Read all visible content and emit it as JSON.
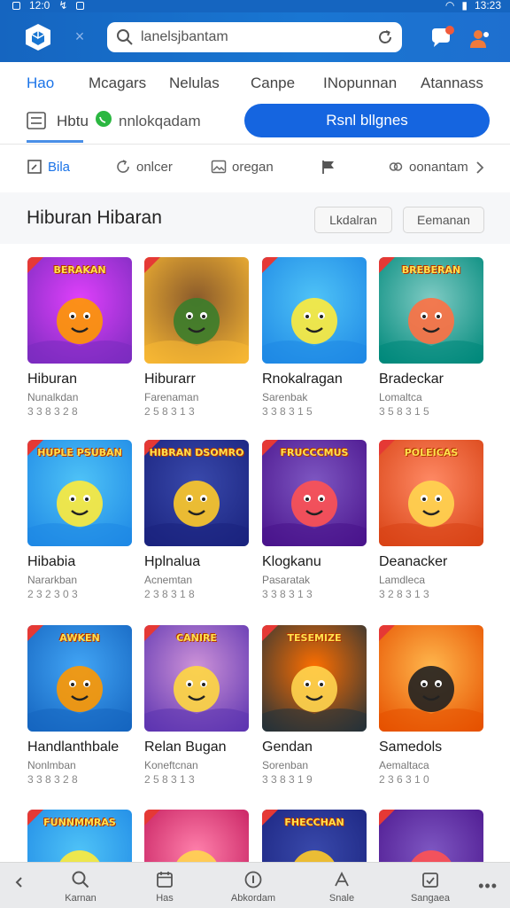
{
  "status_bar": {
    "time_left": "12:0",
    "time_right": "13:23"
  },
  "app_bar": {
    "search_value": "lanelsjbantam",
    "search_placeholder": "lanelsjbantam"
  },
  "category_tabs": [
    {
      "label": "Hao",
      "active": true
    },
    {
      "label": "Mcagars",
      "active": false
    },
    {
      "label": "Nelulas",
      "active": false
    },
    {
      "label": "Canpe",
      "active": false
    },
    {
      "label": "INopunnan",
      "active": false
    },
    {
      "label": "Atannass",
      "active": false
    }
  ],
  "filter": {
    "label": "Hbtu",
    "text": "nnlokqadam",
    "primary_button": "Rsnl bllgnes"
  },
  "chips": [
    {
      "label": "Bila",
      "icon": "square-corner-icon",
      "active": true
    },
    {
      "label": "onlcer",
      "icon": "refresh-icon",
      "active": false
    },
    {
      "label": "oregan",
      "icon": "image-icon",
      "active": false
    },
    {
      "label": "",
      "icon": "flag-icon",
      "active": false
    },
    {
      "label": "oonantam",
      "icon": "link-icon",
      "active": false
    }
  ],
  "section": {
    "title": "Hiburan Hibaran",
    "button_1": "Lkdalran",
    "button_2": "Eemanan"
  },
  "games": [
    {
      "title": "Hiburan",
      "subtitle": "Nunalkdan",
      "meta": "3 3 8 3 2 8",
      "thumb_text": "BERAKAN",
      "theme": "purple"
    },
    {
      "title": "Hiburarr",
      "subtitle": "Farenaman",
      "meta": "2 5 8 3 1 3",
      "thumb_text": "",
      "theme": "sunset"
    },
    {
      "title": "Rnokalragan",
      "subtitle": "Sarenbak",
      "meta": "3 3 8 3 1 5",
      "thumb_text": "",
      "theme": "sky"
    },
    {
      "title": "Bradeckar",
      "subtitle": "Lomaltca",
      "meta": "3 5 8 3 1 5",
      "thumb_text": "BREBERAN",
      "theme": "teal"
    },
    {
      "title": "Hibabia",
      "subtitle": "Nararkban",
      "meta": "2 3 2 3 0 3",
      "thumb_text": "HUPLE PSUBAN",
      "theme": "sky"
    },
    {
      "title": "Hplnalua",
      "subtitle": "Acnemtan",
      "meta": "2 3 8 3 1 8",
      "thumb_text": "HIBRAN DSOMRO",
      "theme": "navy"
    },
    {
      "title": "Klogkanu",
      "subtitle": "Pasaratak",
      "meta": "3 3 8 3 1 3",
      "thumb_text": "FRUCCCMUS",
      "theme": "violet"
    },
    {
      "title": "Deanacker",
      "subtitle": "Lamdleca",
      "meta": "3 2 8 3 1 3",
      "thumb_text": "POLEICAS",
      "theme": "fire"
    },
    {
      "title": "Handlanthbale",
      "subtitle": "Nonlmban",
      "meta": "3 3 8 3 2 8",
      "thumb_text": "AWKEN",
      "theme": "blue"
    },
    {
      "title": "Relan Bugan",
      "subtitle": "Koneftcnan",
      "meta": "2 5 8 3 1 3",
      "thumb_text": "CANIRE",
      "theme": "glow"
    },
    {
      "title": "Gendan",
      "subtitle": "Sorenban",
      "meta": "3 3 8 3 1 9",
      "thumb_text": "TESEMIZE",
      "theme": "dark"
    },
    {
      "title": "Samedols",
      "subtitle": "Aemaltaca",
      "meta": "2 3 6 3 1 0",
      "thumb_text": "",
      "theme": "orange"
    },
    {
      "title": "",
      "subtitle": "",
      "meta": "",
      "thumb_text": "FUNNMMRAS",
      "theme": "sky"
    },
    {
      "title": "",
      "subtitle": "",
      "meta": "",
      "thumb_text": "",
      "theme": "pink"
    },
    {
      "title": "",
      "subtitle": "",
      "meta": "",
      "thumb_text": "FHECCHAN",
      "theme": "navy"
    },
    {
      "title": "",
      "subtitle": "",
      "meta": "",
      "thumb_text": "",
      "theme": "violet"
    }
  ],
  "bottom_nav": [
    {
      "label": "Karnan",
      "icon": "search-icon"
    },
    {
      "label": "Has",
      "icon": "calendar-icon"
    },
    {
      "label": "Abkordam",
      "icon": "info-icon"
    },
    {
      "label": "Snale",
      "icon": "sparkle-icon"
    },
    {
      "label": "Sangaea",
      "icon": "calendar-check-icon"
    }
  ],
  "colors": {
    "brand": "#1565c0",
    "accent": "#1a73e8",
    "primary_button": "#1565e0"
  }
}
